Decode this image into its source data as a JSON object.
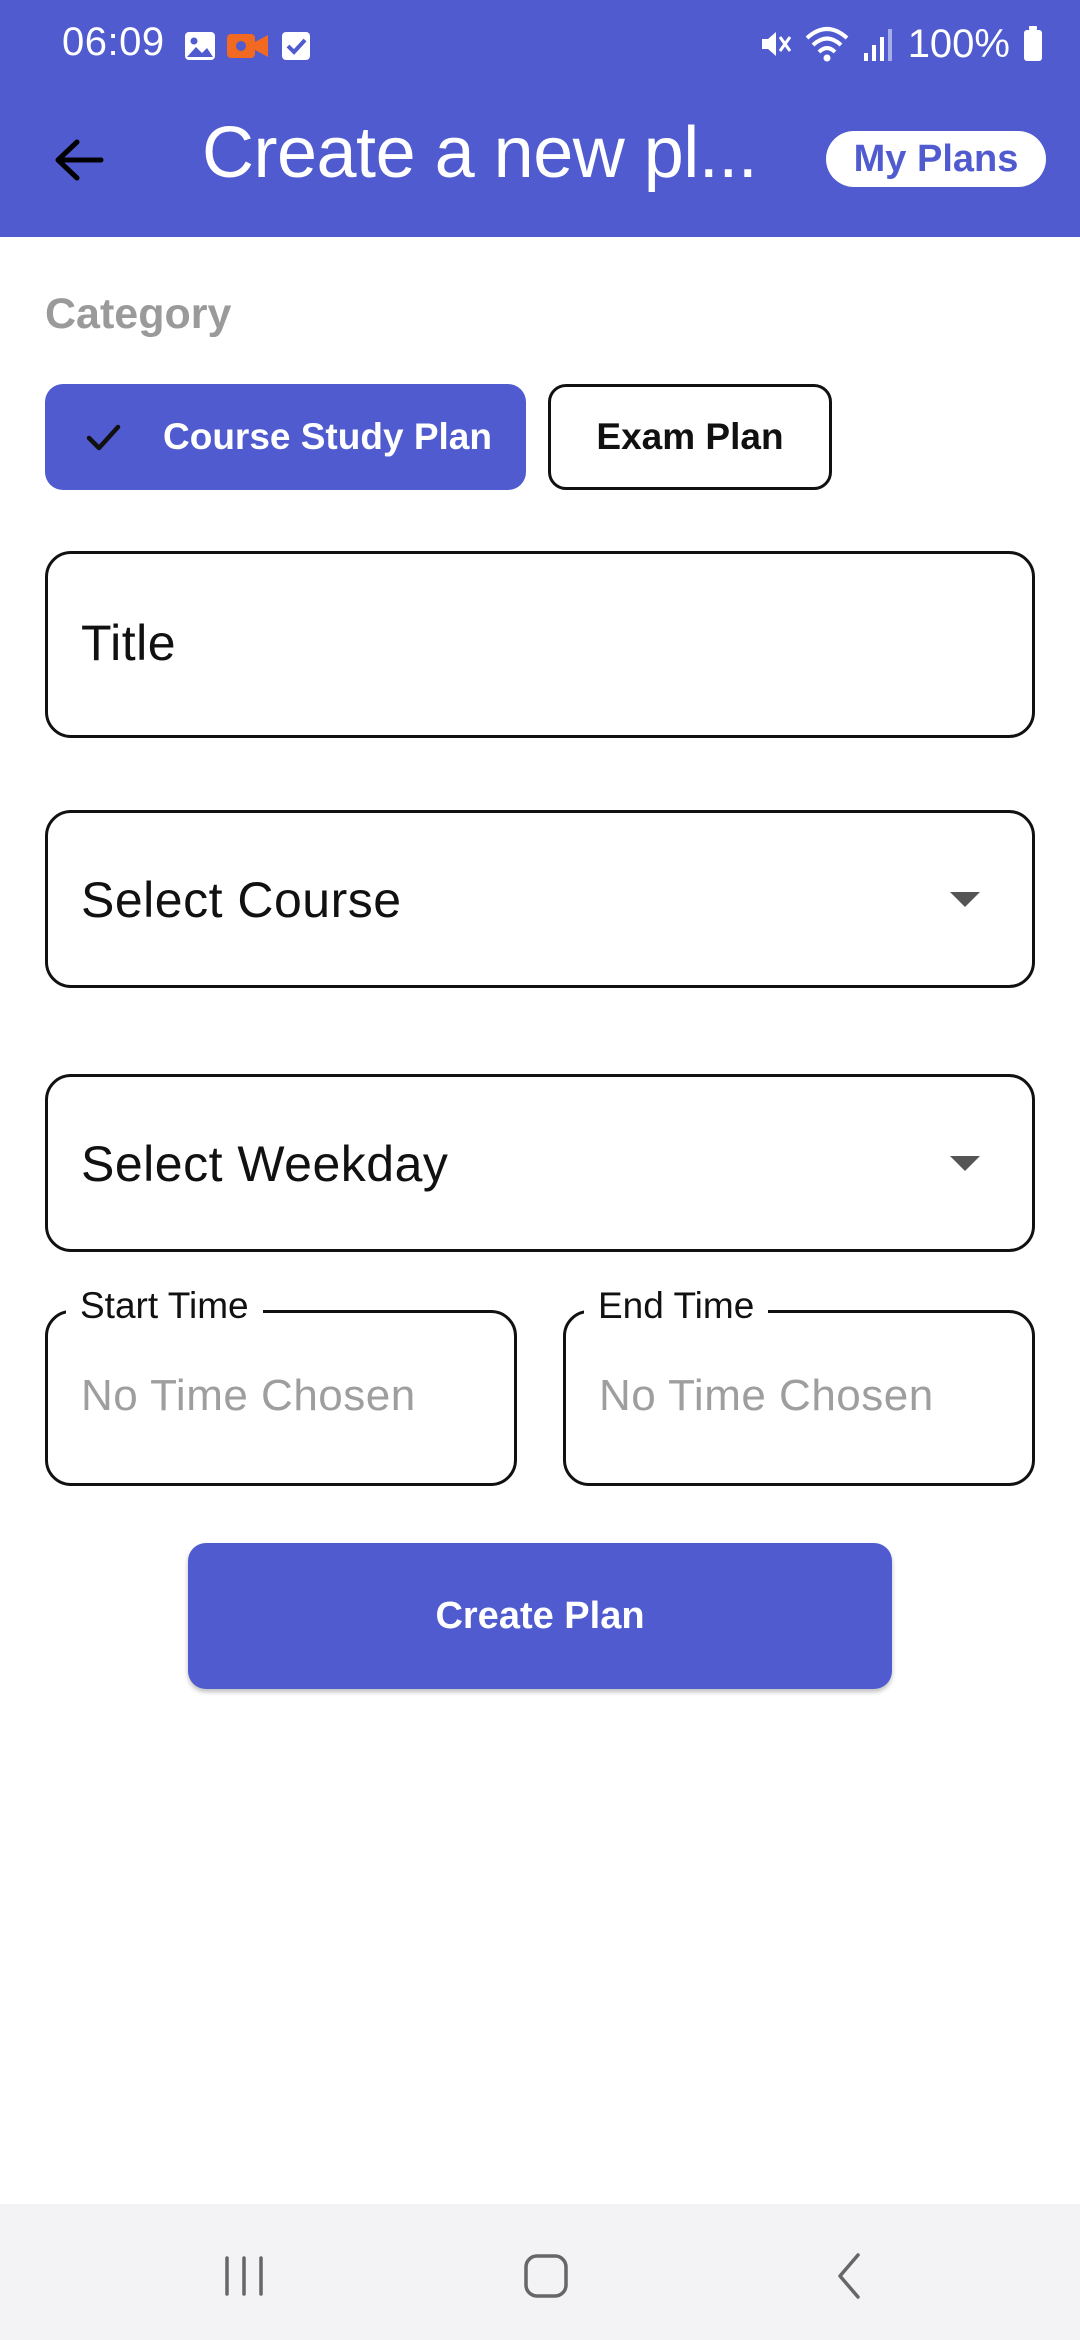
{
  "status_bar": {
    "time": "06:09",
    "battery": "100%",
    "icons": [
      "gallery-icon",
      "video-record-icon",
      "checkbox-icon",
      "mute-icon",
      "wifi-icon",
      "signal-icon",
      "battery-icon"
    ]
  },
  "header": {
    "title": "Create a new pl...",
    "my_plans_label": "My Plans",
    "background_color": "#4f5bcf"
  },
  "form": {
    "category_label": "Category",
    "chips": [
      {
        "label": "Course Study Plan",
        "selected": true
      },
      {
        "label": "Exam Plan",
        "selected": false
      }
    ],
    "title_placeholder": "Title",
    "course_select_label": "Select Course",
    "weekday_select_label": "Select Weekday",
    "start_time": {
      "label": "Start Time",
      "value": "No Time Chosen"
    },
    "end_time": {
      "label": "End Time",
      "value": "No Time Chosen"
    },
    "submit_label": "Create Plan"
  },
  "nav_bar": {
    "buttons": [
      "recent-apps-icon",
      "home-icon",
      "back-icon"
    ]
  }
}
